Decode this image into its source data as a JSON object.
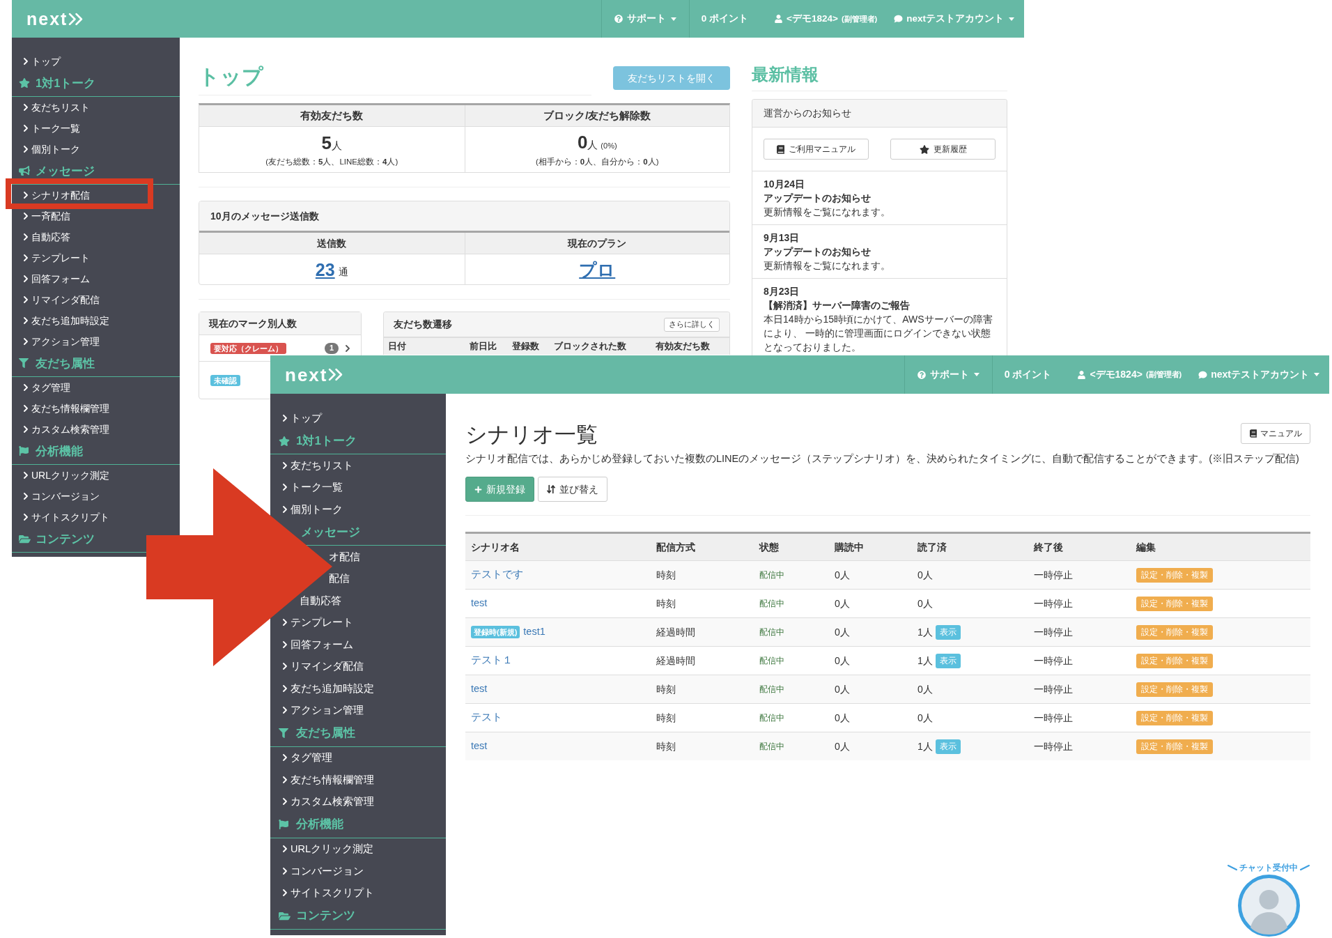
{
  "screenshot_behind": {
    "header": {
      "logo": "next",
      "nav": [
        {
          "kind": "support",
          "label": "サポート",
          "caret": true
        },
        {
          "kind": "points",
          "label": "0 ポイント"
        },
        {
          "kind": "user",
          "label": "<デモ1824>",
          "note": "(副管理者)"
        },
        {
          "kind": "account",
          "label": "nextテストアカウント",
          "caret": true
        }
      ]
    },
    "sidebar": [
      {
        "kind": "link",
        "label": "トップ"
      },
      {
        "kind": "heading",
        "label": "1対1トーク"
      },
      {
        "kind": "link",
        "label": "友だちリスト"
      },
      {
        "kind": "link",
        "label": "トーク一覧"
      },
      {
        "kind": "link",
        "label": "個別トーク"
      },
      {
        "kind": "heading",
        "label": "メッセージ"
      },
      {
        "kind": "link",
        "label": "シナリオ配信"
      },
      {
        "kind": "link",
        "label": "一斉配信"
      },
      {
        "kind": "link",
        "label": "自動応答"
      },
      {
        "kind": "link",
        "label": "テンプレート"
      },
      {
        "kind": "link",
        "label": "回答フォーム"
      },
      {
        "kind": "link",
        "label": "リマインダ配信"
      },
      {
        "kind": "link",
        "label": "友だち追加時設定"
      },
      {
        "kind": "link",
        "label": "アクション管理"
      },
      {
        "kind": "heading",
        "label": "友だち属性"
      },
      {
        "kind": "link",
        "label": "タグ管理"
      },
      {
        "kind": "link",
        "label": "友だち情報欄管理"
      },
      {
        "kind": "link",
        "label": "カスタム検索管理"
      },
      {
        "kind": "heading",
        "label": "分析機能"
      },
      {
        "kind": "link",
        "label": "URLクリック測定"
      },
      {
        "kind": "link",
        "label": "コンバージョン"
      },
      {
        "kind": "link",
        "label": "サイトスクリプト"
      },
      {
        "kind": "heading",
        "label": "コンテンツ"
      }
    ],
    "page_title": "トップ",
    "open_friends_button": "友だちリストを開く",
    "stats": [
      {
        "heading": "有効友だち数",
        "value": "5",
        "unit": "人",
        "detail": "(友だち総数：**5**人、LINE総数：**4**人)"
      },
      {
        "heading": "ブロック/友だち解除数",
        "value": "0",
        "unit": "人",
        "ratio": "(0%)",
        "detail": "(相手から：**0**人、自分から：**0**人)"
      }
    ],
    "message_panel": {
      "title": "10月のメッセージ送信数",
      "columns": [
        {
          "heading": "送信数",
          "value": "23",
          "unit": "通"
        },
        {
          "heading": "現在のプラン",
          "value": "プロ"
        }
      ]
    },
    "marks": {
      "title": "現在のマーク別人数",
      "rows": [
        {
          "label": "要対応（クレーム）",
          "color": "#d9534f",
          "count": "1"
        },
        {
          "label": "未確認",
          "color": "#5bc0de"
        }
      ]
    },
    "friend_trend": {
      "title": "友だち数遷移",
      "button": "さらに詳しく",
      "columns": [
        "日付",
        "前日比",
        "登録数",
        "ブロックされた数",
        "有効友だち数"
      ]
    },
    "news": {
      "title": "最新情報",
      "panel_title": "運営からのお知らせ",
      "buttons": [
        {
          "label": "ご利用マニュアル"
        },
        {
          "label": "更新履歴"
        }
      ],
      "items": [
        {
          "date": "10月24日",
          "title": "アップデートのお知らせ",
          "body": "更新情報をご覧になれます。"
        },
        {
          "date": "9月13日",
          "title": "アップデートのお知らせ",
          "body": "更新情報をご覧になれます。"
        },
        {
          "date": "8月23日",
          "title": "【解消済】サーバー障害のご報告",
          "body": "本日14時から15時頃にかけて、AWSサーバーの障害により、 一時的に管理画面にログインできない状態となっておりました。"
        }
      ]
    }
  },
  "screenshot_front": {
    "header": {
      "logo": "next",
      "nav": [
        {
          "kind": "support",
          "label": "サポート",
          "caret": true
        },
        {
          "kind": "points",
          "label": "0 ポイント"
        },
        {
          "kind": "user",
          "label": "<デモ1824>",
          "note": "(副管理者)"
        },
        {
          "kind": "account",
          "label": "nextテストアカウント",
          "caret": true
        }
      ]
    },
    "sidebar": [
      {
        "kind": "link",
        "label": "トップ"
      },
      {
        "kind": "heading",
        "label": "1対1トーク"
      },
      {
        "kind": "link",
        "label": "友だちリスト"
      },
      {
        "kind": "link",
        "label": "トーク一覧"
      },
      {
        "kind": "link",
        "label": "個別トーク"
      },
      {
        "kind": "heading_covered",
        "label": "メッセージ"
      },
      {
        "kind": "link_covered",
        "label": "オ配信"
      },
      {
        "kind": "link_covered",
        "label": "配信"
      },
      {
        "kind": "link_chevron_covered",
        "label": "自動応答"
      },
      {
        "kind": "link",
        "label": "テンプレート"
      },
      {
        "kind": "link",
        "label": "回答フォーム"
      },
      {
        "kind": "link",
        "label": "リマインダ配信"
      },
      {
        "kind": "link",
        "label": "友だち追加時設定"
      },
      {
        "kind": "link",
        "label": "アクション管理"
      },
      {
        "kind": "heading",
        "label": "友だち属性"
      },
      {
        "kind": "link",
        "label": "タグ管理"
      },
      {
        "kind": "link",
        "label": "友だち情報欄管理"
      },
      {
        "kind": "link",
        "label": "カスタム検索管理"
      },
      {
        "kind": "heading",
        "label": "分析機能"
      },
      {
        "kind": "link",
        "label": "URLクリック測定"
      },
      {
        "kind": "link",
        "label": "コンバージョン"
      },
      {
        "kind": "link",
        "label": "サイトスクリプト"
      },
      {
        "kind": "heading",
        "label": "コンテンツ"
      }
    ],
    "page": {
      "title": "シナリオ一覧",
      "manual_button": "マニュアル",
      "description": "シナリオ配信では、あらかじめ登録しておいた複数のLINEのメッセージ（ステップシナリオ）を、決められたタイミングに、自動で配信することができます。(※旧ステップ配信)",
      "actions": [
        {
          "kind": "primary",
          "label": "新規登録"
        },
        {
          "kind": "default",
          "label": "並び替え"
        }
      ],
      "table": {
        "columns": [
          "シナリオ名",
          "配信方式",
          "状態",
          "購読中",
          "読了済",
          "終了後",
          "編集"
        ],
        "rows": [
          {
            "name": "テストです",
            "method": "時刻",
            "status": "配信中",
            "subscribed": "0人",
            "read": "0人",
            "after_end": "一時停止",
            "edit": "設定・削除・複製"
          },
          {
            "name": "test",
            "method": "時刻",
            "status": "配信中",
            "subscribed": "0人",
            "read": "0人",
            "after_end": "一時停止",
            "edit": "設定・削除・複製"
          },
          {
            "tag": "登録時(新規)",
            "name": "test1",
            "method": "経過時間",
            "status": "配信中",
            "subscribed": "0人",
            "read": "1人",
            "read_button": "表示",
            "after_end": "一時停止",
            "edit": "設定・削除・複製"
          },
          {
            "name": "テスト１",
            "method": "経過時間",
            "status": "配信中",
            "subscribed": "0人",
            "read": "1人",
            "read_button": "表示",
            "after_end": "一時停止",
            "edit": "設定・削除・複製"
          },
          {
            "name": "test",
            "method": "時刻",
            "status": "配信中",
            "subscribed": "0人",
            "read": "0人",
            "after_end": "一時停止",
            "edit": "設定・削除・複製"
          },
          {
            "name": "テスト",
            "method": "時刻",
            "status": "配信中",
            "subscribed": "0人",
            "read": "0人",
            "after_end": "一時停止",
            "edit": "設定・削除・複製"
          },
          {
            "name": "test",
            "method": "時刻",
            "status": "配信中",
            "subscribed": "0人",
            "read": "1人",
            "read_button": "表示",
            "after_end": "一時停止",
            "edit": "設定・削除・複製"
          }
        ]
      }
    }
  },
  "chat_widget": {
    "label": "チャット受付中"
  }
}
